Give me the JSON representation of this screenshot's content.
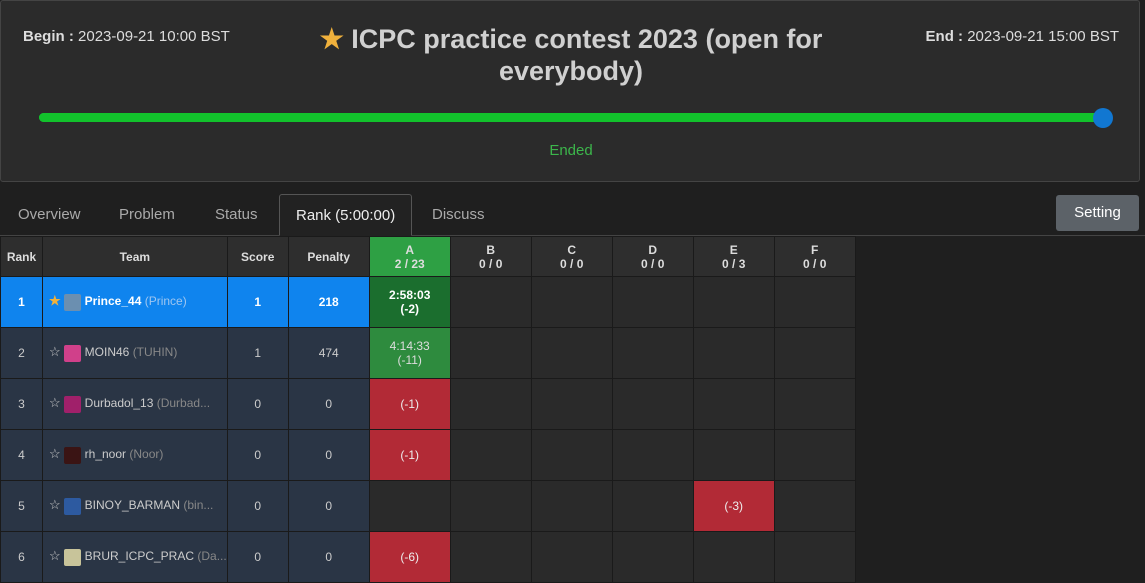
{
  "contest": {
    "begin_label": "Begin :",
    "begin_value": "2023-09-21 10:00 BST",
    "end_label": "End :",
    "end_value": "2023-09-21 15:00 BST",
    "star": "★",
    "title": "ICPC practice contest 2023 (open for everybody)",
    "status": "Ended",
    "progress": 1.0
  },
  "tabs": [
    "Overview",
    "Problem",
    "Status",
    "Rank (5:00:00)",
    "Discuss"
  ],
  "active_tab": "Rank (5:00:00)",
  "setting_label": "Setting",
  "columns": {
    "rank": "Rank",
    "team": "Team",
    "score": "Score",
    "penalty": "Penalty"
  },
  "problems": [
    {
      "id": "A",
      "stat": "2 / 23"
    },
    {
      "id": "B",
      "stat": "0 / 0"
    },
    {
      "id": "C",
      "stat": "0 / 0"
    },
    {
      "id": "D",
      "stat": "0 / 0"
    },
    {
      "id": "E",
      "stat": "0 / 3"
    },
    {
      "id": "F",
      "stat": "0 / 0"
    }
  ],
  "rows": [
    {
      "rank": "1",
      "name": "Prince_44",
      "nick": "(Prince)",
      "score": "1",
      "penalty": "218",
      "starred": true,
      "avatar_color": "#6b8fb0",
      "cells": [
        {
          "t": "2:58:03",
          "s": "(-2)",
          "k": "first"
        },
        {},
        {},
        {},
        {},
        {}
      ]
    },
    {
      "rank": "2",
      "name": "MOIN46",
      "nick": "(TUHIN)",
      "score": "1",
      "penalty": "474",
      "starred": false,
      "avatar_color": "#d0408a",
      "cells": [
        {
          "t": "4:14:33",
          "s": "(-11)",
          "k": "ac"
        },
        {},
        {},
        {},
        {},
        {}
      ]
    },
    {
      "rank": "3",
      "name": "Durbadol_13",
      "nick": "(Durbad...",
      "score": "0",
      "penalty": "0",
      "starred": false,
      "avatar_color": "#a0206a",
      "cells": [
        {
          "s": "(-1)",
          "k": "wa"
        },
        {},
        {},
        {},
        {},
        {}
      ]
    },
    {
      "rank": "4",
      "name": "rh_noor",
      "nick": "(Noor)",
      "score": "0",
      "penalty": "0",
      "starred": false,
      "avatar_color": "#3a1414",
      "cells": [
        {
          "s": "(-1)",
          "k": "wa"
        },
        {},
        {},
        {},
        {},
        {}
      ]
    },
    {
      "rank": "5",
      "name": "BINOY_BARMAN",
      "nick": "(bin...",
      "score": "0",
      "penalty": "0",
      "starred": false,
      "avatar_color": "#2d5aa0",
      "cells": [
        {},
        {},
        {},
        {},
        {
          "s": "(-3)",
          "k": "wa"
        },
        {}
      ]
    },
    {
      "rank": "6",
      "name": "BRUR_ICPC_PRAC",
      "nick": "(Da...",
      "score": "0",
      "penalty": "0",
      "starred": false,
      "avatar_color": "#c8c49a",
      "cells": [
        {
          "s": "(-6)",
          "k": "wa"
        },
        {},
        {},
        {},
        {},
        {}
      ]
    }
  ]
}
